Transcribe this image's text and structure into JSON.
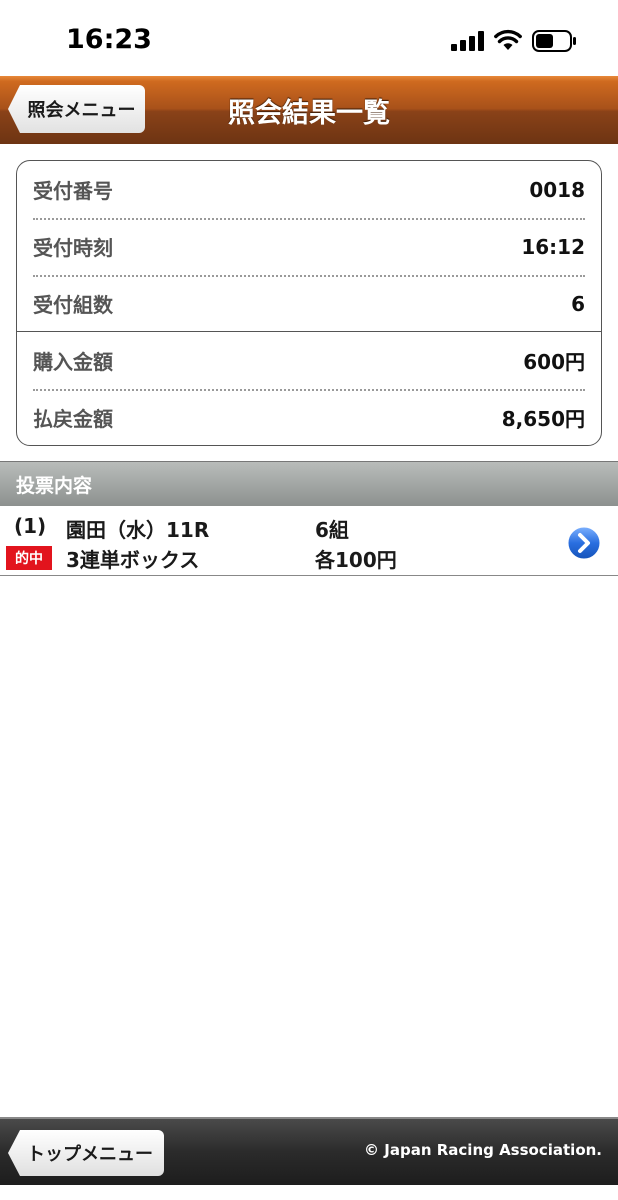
{
  "status_bar": {
    "time": "16:23",
    "signal_icon": "cellular-signal-icon",
    "wifi_icon": "wifi-icon",
    "battery_icon": "battery-icon"
  },
  "nav": {
    "back_label": "照会メニュー",
    "title": "照会結果一覧",
    "accent_color": "#a8511a"
  },
  "summary": {
    "rows": [
      {
        "label": "受付番号",
        "value": "0018"
      },
      {
        "label": "受付時刻",
        "value": "16:12"
      },
      {
        "label": "受付組数",
        "value": "6"
      },
      {
        "label": "購入金額",
        "value": "600円"
      },
      {
        "label": "払戻金額",
        "value": "8,650円"
      }
    ]
  },
  "section": {
    "title": "投票内容"
  },
  "bets": [
    {
      "index": "(1)",
      "venue": "園田（水）11R",
      "combos": "6組",
      "badge": "的中",
      "badge_color": "#e2141d",
      "type": "3連単ボックス",
      "amount": "各100円",
      "detail_icon": "chevron-right-icon"
    }
  ],
  "footer": {
    "top_menu_label": "トップメニュー",
    "copyright": "© Japan Racing Association."
  }
}
